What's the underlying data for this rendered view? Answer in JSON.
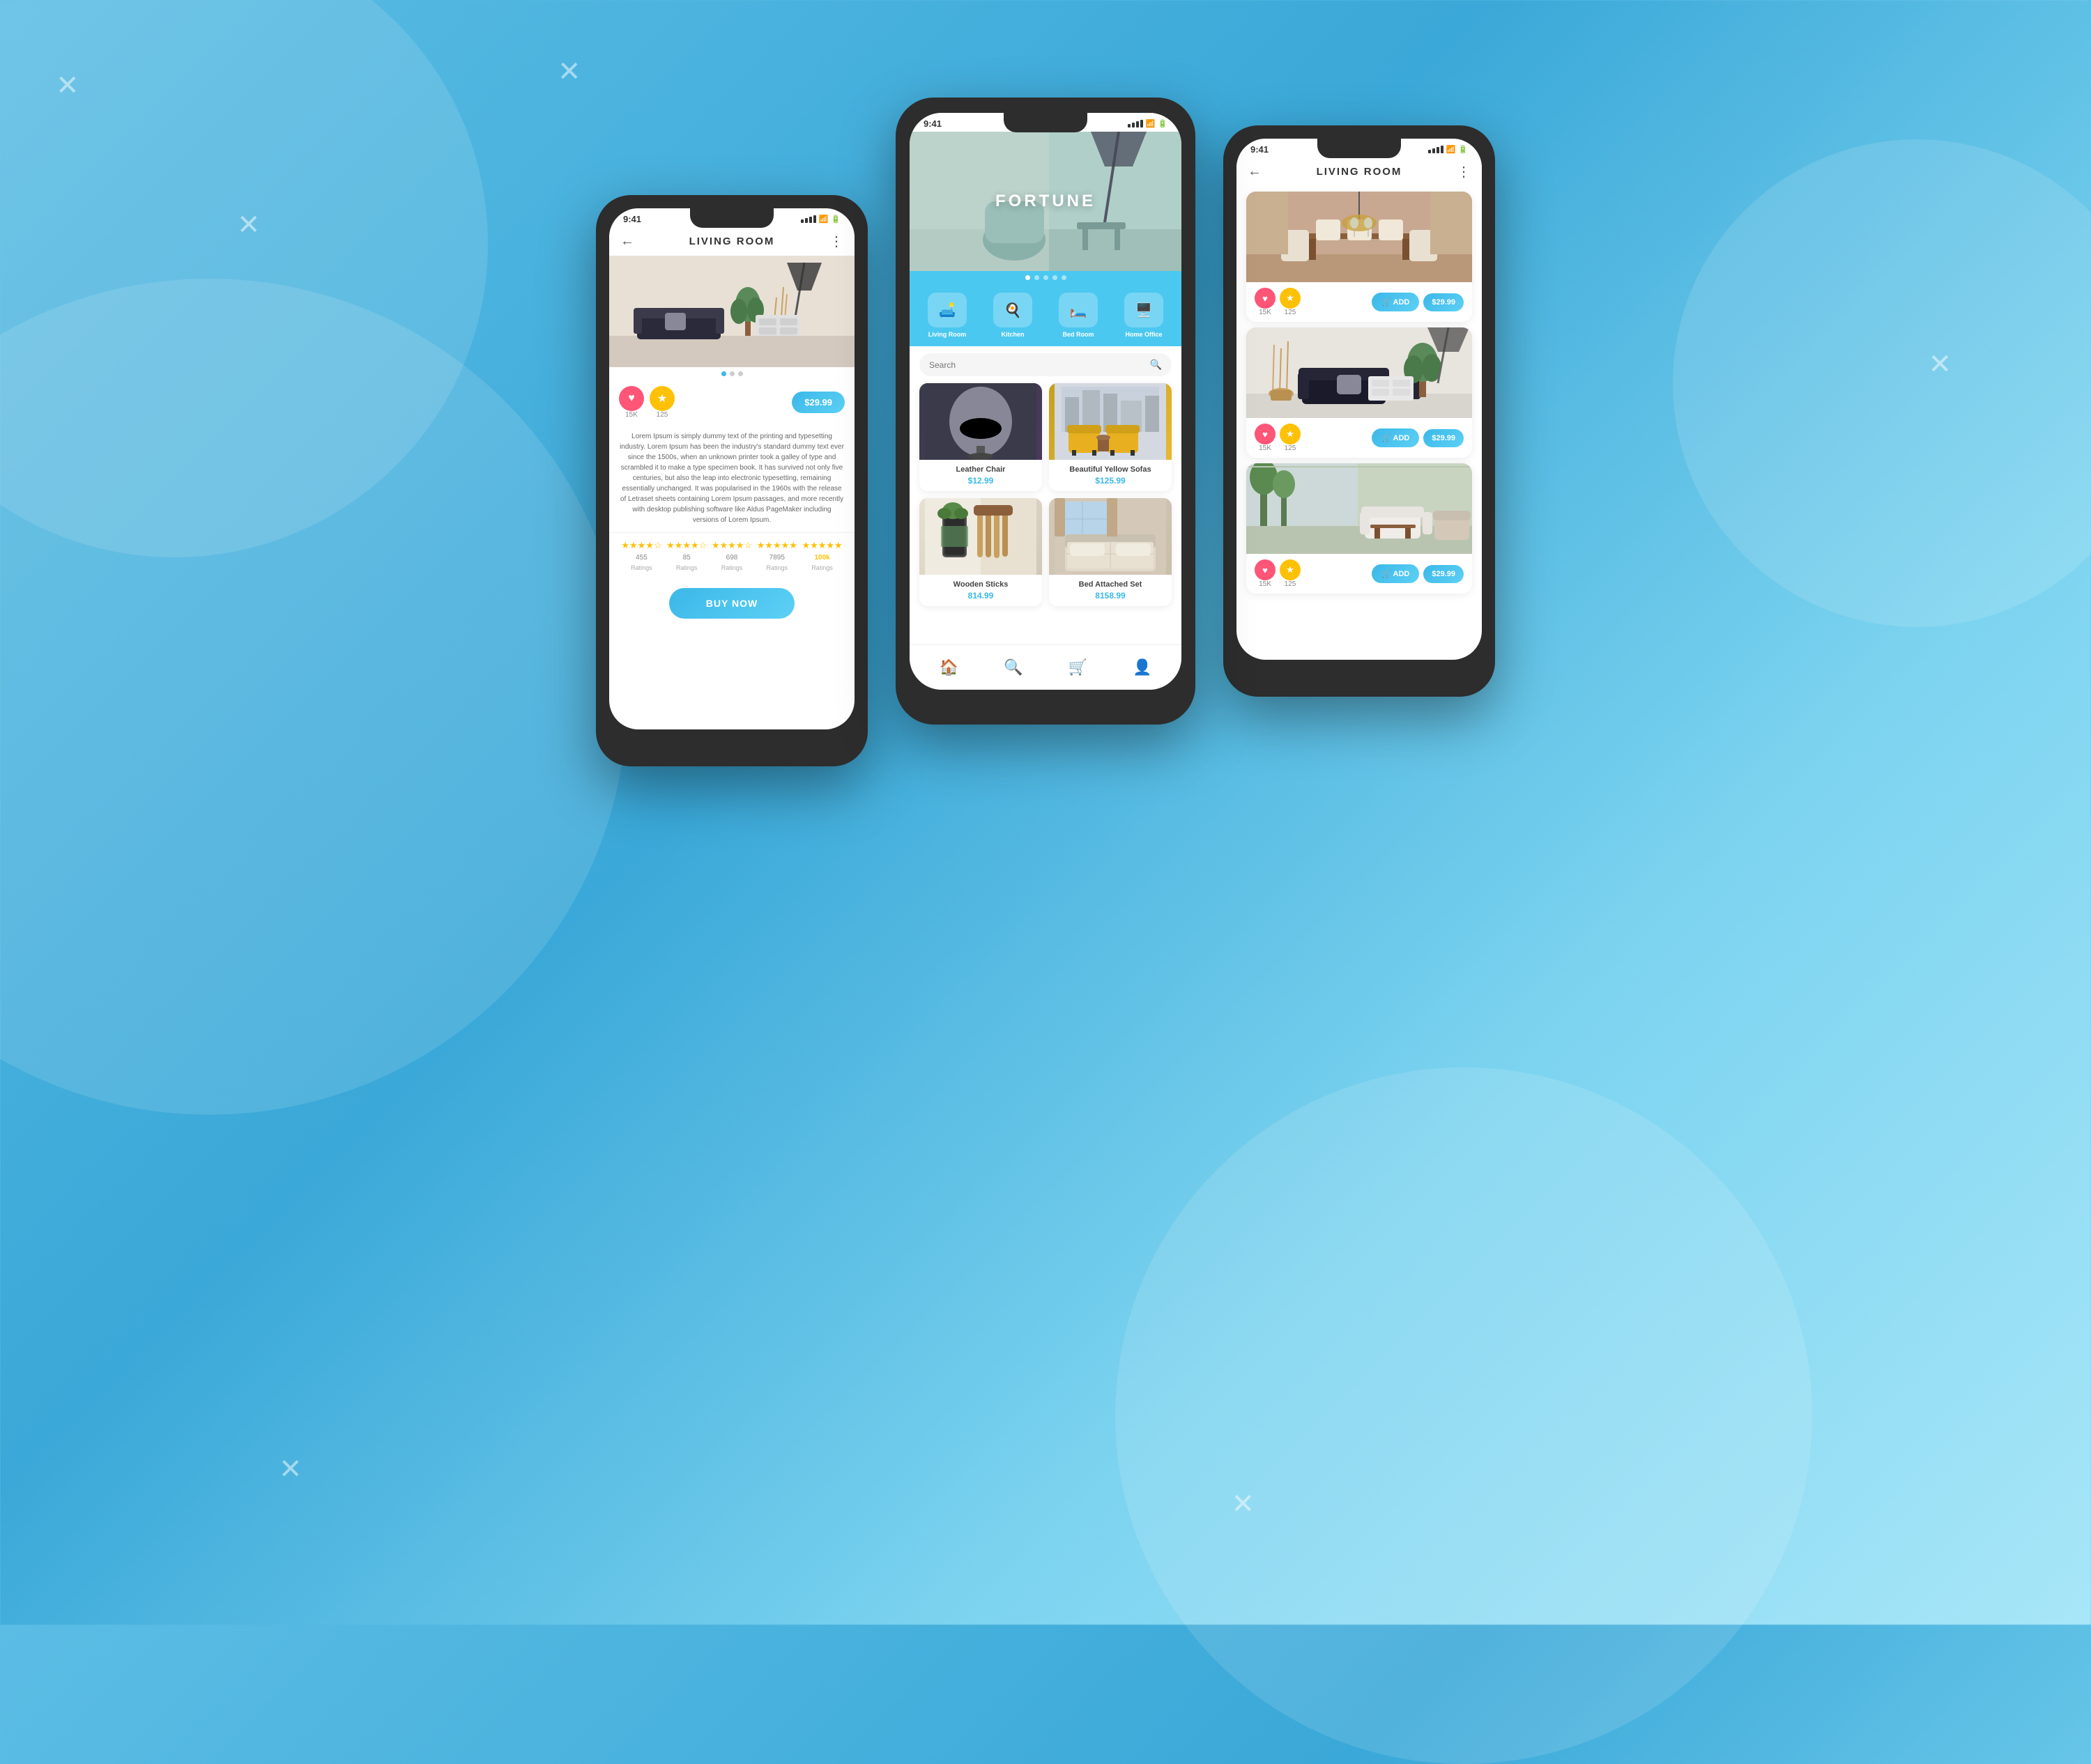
{
  "background": {
    "gradient_start": "#5bbde4",
    "gradient_end": "#a8e6f8"
  },
  "left_phone": {
    "status_bar": {
      "time": "9:41",
      "signal": "●●●●",
      "wifi": "WiFi",
      "battery": "🔋"
    },
    "header": {
      "title": "LIVING ROOM",
      "back_label": "←",
      "more_label": "⋮"
    },
    "dots": [
      "active",
      "inactive",
      "inactive"
    ],
    "heart_count": "15K",
    "star_count": "125",
    "price": "$29.99",
    "description": "Lorem Ipsum is simply dummy text of the printing and typesetting industry. Lorem Ipsum has been the industry's standard dummy text ever since the 1500s, when an unknown printer took a galley of type and scrambled it to make a type specimen book. It has survived not only five centuries, but also the leap into electronic typesetting, remaining essentially unchanged. It was popularised in the 1960s with the release of Letraset sheets containing Lorem Ipsum passages, and more recently with desktop publishing software like Aldus PageMaker including versions of Lorem Ipsum.",
    "ratings": [
      {
        "stars": "★★★★☆",
        "count": "455",
        "label": "Ratings"
      },
      {
        "stars": "★★★★☆",
        "count": "85",
        "label": "Ratings"
      },
      {
        "stars": "★★★★☆",
        "count": "698",
        "label": "Ratings"
      },
      {
        "stars": "★★★★★",
        "count": "7895",
        "label": "Ratings"
      },
      {
        "stars": "★★★★★",
        "count": "100k",
        "label": "Ratings",
        "highlighted": true
      }
    ],
    "buy_now_label": "BUY NOW"
  },
  "center_phone": {
    "status_bar": {
      "time": "9:41",
      "signal": "●●●●",
      "wifi": "WiFi",
      "battery": "🔋"
    },
    "banner_title": "FORTUNE",
    "banner_dots": [
      "active",
      "inactive",
      "inactive",
      "inactive",
      "inactive"
    ],
    "categories": [
      {
        "label": "Living Room",
        "icon": "🛋️"
      },
      {
        "label": "Kitchen",
        "icon": "🍳"
      },
      {
        "label": "Bed Room",
        "icon": "🛏️"
      },
      {
        "label": "Home Office",
        "icon": "🖥️"
      }
    ],
    "search_placeholder": "Search",
    "products": [
      {
        "name": "Leather Chair",
        "price": "$12.99",
        "img_class": "img-chair"
      },
      {
        "name": "Beautiful Yellow Sofas",
        "price": "$125.99",
        "img_class": "img-sofa"
      },
      {
        "name": "Wooden Sticks",
        "price": "814.99",
        "img_class": "img-kitchen"
      },
      {
        "name": "Bed Attached Set",
        "price": "8158.99",
        "img_class": "img-bed"
      }
    ],
    "nav": [
      "home",
      "search",
      "cart",
      "profile"
    ]
  },
  "right_phone": {
    "status_bar": {
      "time": "9:41",
      "signal": "●●●●",
      "wifi": "WiFi",
      "battery": "🔋"
    },
    "header": {
      "title": "LIVING ROOM",
      "back_label": "←",
      "more_label": "⋮"
    },
    "cards": [
      {
        "img_class": "img-room1",
        "heart_count": "15K",
        "star_count": "125",
        "add_label": "🛒 ADD",
        "price": "$29.99"
      },
      {
        "img_class": "img-room2",
        "heart_count": "15K",
        "star_count": "125",
        "add_label": "🛒 ADD",
        "price": "$29.99"
      },
      {
        "img_class": "img-room3",
        "heart_count": "15K",
        "star_count": "125",
        "add_label": "🛒 ADD",
        "price": "$29.99"
      }
    ]
  },
  "icons": {
    "heart": "♥",
    "star": "★",
    "back": "←",
    "more": "⋮",
    "search": "🔍",
    "home": "🏠",
    "cart": "🛒",
    "profile": "👤",
    "add_to_cart": "🛒"
  }
}
